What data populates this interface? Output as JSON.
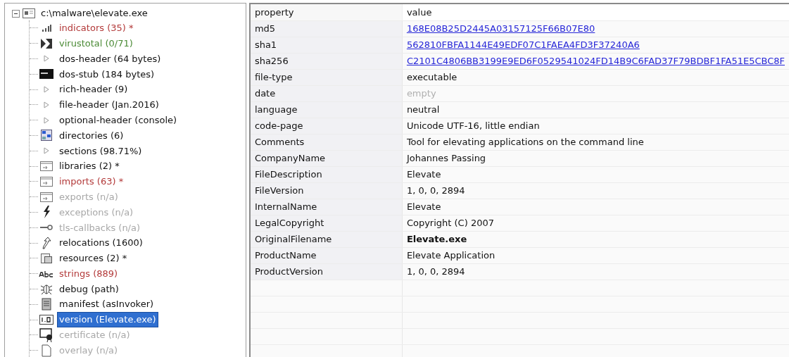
{
  "tree": {
    "label": "c:\\malware\\elevate.exe",
    "expanded": true,
    "children": [
      {
        "label": "indicators (35) *",
        "kind": "bars",
        "color": "#b33a3a",
        "selected": false
      },
      {
        "label": "virustotal (0/71)",
        "kind": "vt",
        "color": "#4a8a35",
        "selected": false
      },
      {
        "label": "dos-header (64 bytes)",
        "kind": "triangle",
        "color": "#111111",
        "selected": false
      },
      {
        "label": "dos-stub (184 bytes)",
        "kind": "console",
        "color": "#111111",
        "selected": false
      },
      {
        "label": "rich-header (9)",
        "kind": "triangle",
        "color": "#111111",
        "selected": false
      },
      {
        "label": "file-header (Jan.2016)",
        "kind": "triangle",
        "color": "#111111",
        "selected": false
      },
      {
        "label": "optional-header (console)",
        "kind": "triangle",
        "color": "#111111",
        "selected": false
      },
      {
        "label": "directories (6)",
        "kind": "grid",
        "color": "#111111",
        "selected": false
      },
      {
        "label": "sections (98.71%)",
        "kind": "triangle",
        "color": "#111111",
        "selected": false
      },
      {
        "label": "libraries (2) *",
        "kind": "window",
        "color": "#111111",
        "selected": false
      },
      {
        "label": "imports (63) *",
        "kind": "window",
        "color": "#b33a3a",
        "selected": false
      },
      {
        "label": "exports (n/a)",
        "kind": "window",
        "color": "#a8a8a8",
        "selected": false
      },
      {
        "label": "exceptions (n/a)",
        "kind": "bolt",
        "color": "#a8a8a8",
        "selected": false
      },
      {
        "label": "tls-callbacks (n/a)",
        "kind": "key",
        "color": "#a8a8a8",
        "selected": false
      },
      {
        "label": "relocations (1600)",
        "kind": "arrow",
        "color": "#111111",
        "selected": false
      },
      {
        "label": "resources (2) *",
        "kind": "stack",
        "color": "#111111",
        "selected": false
      },
      {
        "label": "strings (889)",
        "kind": "abc",
        "color": "#b33a3a",
        "selected": false
      },
      {
        "label": "debug (path)",
        "kind": "bug",
        "color": "#111111",
        "selected": false
      },
      {
        "label": "manifest (asInvoker)",
        "kind": "scroll",
        "color": "#111111",
        "selected": false
      },
      {
        "label": "version (Elevate.exe)",
        "kind": "version",
        "selected": true
      },
      {
        "label": "certificate (n/a)",
        "kind": "cert",
        "color": "#a8a8a8",
        "selected": false
      },
      {
        "label": "overlay (n/a)",
        "kind": "page",
        "color": "#a8a8a8",
        "selected": false
      }
    ]
  },
  "table": {
    "columns": [
      "property",
      "value"
    ],
    "rows": [
      {
        "property": "md5",
        "value": "168E08B25D2445A03157125F66B07E80",
        "kind": "link"
      },
      {
        "property": "sha1",
        "value": "562810FBFA1144E49EDF07C1FAEA4FD3F37240A6",
        "kind": "link"
      },
      {
        "property": "sha256",
        "value": "C2101C4806BB3199E9ED6F0529541024FD14B9C6FAD37F79BDBF1FA51E5CBC8F",
        "kind": "link"
      },
      {
        "property": "file-type",
        "value": "executable",
        "kind": "plain"
      },
      {
        "property": "date",
        "value": "empty",
        "kind": "muted"
      },
      {
        "property": "language",
        "value": "neutral",
        "kind": "plain"
      },
      {
        "property": "code-page",
        "value": "Unicode UTF-16, little endian",
        "kind": "plain"
      },
      {
        "property": "Comments",
        "value": "Tool for elevating applications on the command line",
        "kind": "plain"
      },
      {
        "property": "CompanyName",
        "value": "Johannes Passing",
        "kind": "plain"
      },
      {
        "property": "FileDescription",
        "value": "Elevate",
        "kind": "plain"
      },
      {
        "property": "FileVersion",
        "value": "1, 0, 0, 2894",
        "kind": "plain"
      },
      {
        "property": "InternalName",
        "value": "Elevate",
        "kind": "plain"
      },
      {
        "property": "LegalCopyright",
        "value": "Copyright (C) 2007",
        "kind": "plain"
      },
      {
        "property": "OriginalFilename",
        "value": "Elevate.exe",
        "kind": "bold"
      },
      {
        "property": "ProductName",
        "value": "Elevate Application",
        "kind": "plain"
      },
      {
        "property": "ProductVersion",
        "value": "1, 0, 0, 2894",
        "kind": "plain"
      }
    ]
  }
}
